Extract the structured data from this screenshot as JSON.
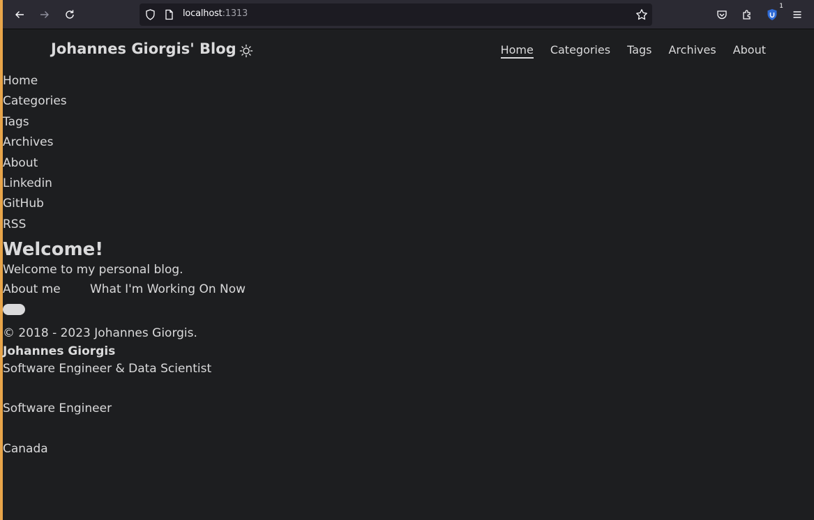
{
  "browser": {
    "url_host": "localhost",
    "url_port": ":1313",
    "extension_badge": "1"
  },
  "site": {
    "title": "Johannes Giorgis' Blog",
    "menu": [
      "Home",
      "Categories",
      "Tags",
      "Archives",
      "About"
    ],
    "active_menu": "Home"
  },
  "social_links": [
    "Home",
    "Categories",
    "Tags",
    "Archives",
    "About",
    "Linkedin",
    "GitHub",
    "RSS"
  ],
  "welcome": {
    "title": "Welcome!",
    "text": "Welcome to my personal blog.",
    "buttons": [
      "About me",
      "What I'm Working On Now"
    ]
  },
  "footer": {
    "copyright": "© 2018 - 2023 Johannes Giorgis.",
    "author_name": "Johannes Giorgis",
    "author_description": "Software Engineer & Data Scientist",
    "job_title": "Software Engineer",
    "location": "Canada"
  },
  "colors": {
    "background": "#1d1e20",
    "text": "#dadadb",
    "chrome": "#2b2a33",
    "window_accent": "#e8a54a"
  }
}
